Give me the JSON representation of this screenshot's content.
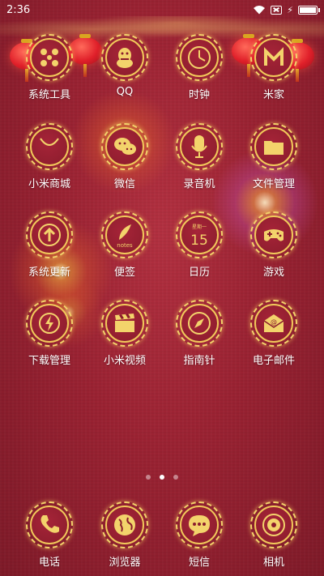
{
  "status_bar": {
    "time": "2:36"
  },
  "home_apps": [
    {
      "label": "系统工具",
      "icon": "tools-grid-icon"
    },
    {
      "label": "QQ",
      "icon": "qq-penguin-icon"
    },
    {
      "label": "时钟",
      "icon": "clock-icon"
    },
    {
      "label": "米家",
      "icon": "mijia-icon"
    },
    {
      "label": "小米商城",
      "icon": "shopping-bag-icon"
    },
    {
      "label": "微信",
      "icon": "wechat-icon"
    },
    {
      "label": "录音机",
      "icon": "microphone-icon"
    },
    {
      "label": "文件管理",
      "icon": "folder-icon"
    },
    {
      "label": "系统更新",
      "icon": "update-arrow-icon"
    },
    {
      "label": "便签",
      "icon": "notes-feather-icon",
      "icon_text": "notes"
    },
    {
      "label": "日历",
      "icon": "calendar-icon",
      "icon_text": "星期一",
      "day": "15"
    },
    {
      "label": "游戏",
      "icon": "gamepad-icon"
    },
    {
      "label": "下载管理",
      "icon": "download-bolt-icon"
    },
    {
      "label": "小米视频",
      "icon": "clapperboard-icon"
    },
    {
      "label": "指南针",
      "icon": "compass-icon"
    },
    {
      "label": "电子邮件",
      "icon": "email-icon"
    }
  ],
  "page_indicator": {
    "count": 3,
    "active": 2
  },
  "dock_apps": [
    {
      "label": "电话",
      "icon": "phone-icon"
    },
    {
      "label": "浏览器",
      "icon": "globe-icon"
    },
    {
      "label": "短信",
      "icon": "message-bubble-icon"
    },
    {
      "label": "相机",
      "icon": "camera-lens-icon"
    }
  ],
  "colors": {
    "background": "#9a2232",
    "gold": "#f3d36b"
  }
}
